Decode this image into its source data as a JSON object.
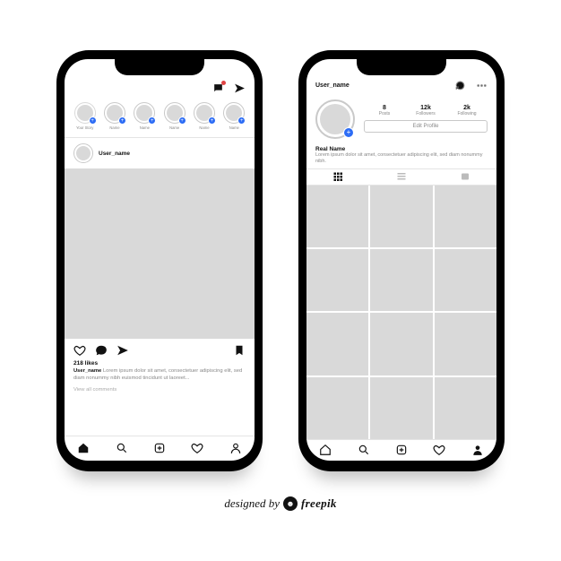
{
  "feed": {
    "stories": [
      {
        "label": "Your Story",
        "self": true
      },
      {
        "label": "Name"
      },
      {
        "label": "Name"
      },
      {
        "label": "Name"
      },
      {
        "label": "Name"
      },
      {
        "label": "Name"
      }
    ],
    "post": {
      "username": "User_name",
      "likes": "218 likes",
      "caption_user": "User_name",
      "caption": "Lorem ipsum dolor sit amet, consectetuer adipiscing elit, sed diam nonummy nibh euismod tincidunt ut laoreet...",
      "view_comments": "View all comments"
    }
  },
  "profile": {
    "username": "User_name",
    "stats": {
      "posts": {
        "n": "8",
        "l": "Posts"
      },
      "followers": {
        "n": "12k",
        "l": "Followers"
      },
      "following": {
        "n": "2k",
        "l": "Following"
      }
    },
    "edit_label": "Edit Profile",
    "real_name": "Real Name",
    "bio": "Lorem ipsum dolor sit amet, consectetuer adipiscing elit, sed diam nonummy nibh."
  },
  "attribution": {
    "pre": "designed by",
    "brand": "freepik"
  }
}
